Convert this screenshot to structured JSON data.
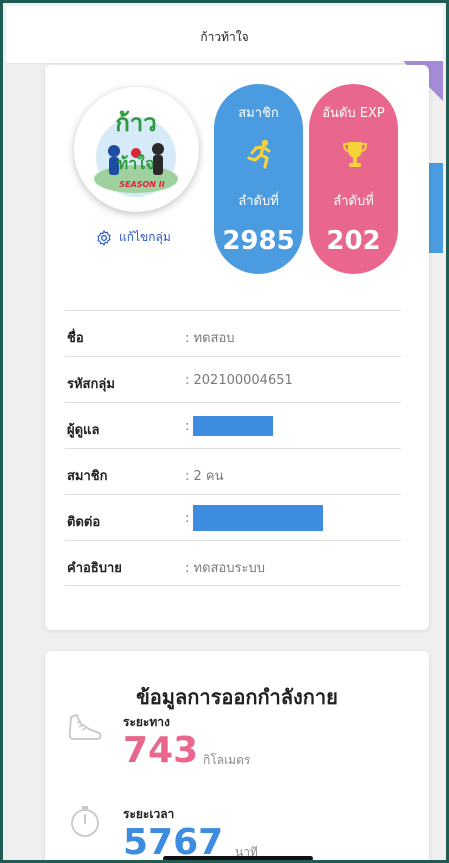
{
  "header": {
    "title": "ก้าวท้าใจ"
  },
  "profile": {
    "edit_label": "แก้ไขกลุ่ม",
    "logo": {
      "top_text": "ก้าว",
      "bottom_text": "ท้าใจ",
      "season_text": "SEASON II",
      "colors": {
        "green": "#2e9a3e",
        "blue": "#1c4da0",
        "red": "#d9263a"
      }
    }
  },
  "members_pill": {
    "title": "สมาชิก",
    "rank_label": "ลำดับที่",
    "rank": "2985",
    "color": "#4a9be0",
    "icon": "running-icon"
  },
  "exp_pill": {
    "title": "อันดับ EXP",
    "rank_label": "ลำดับที่",
    "rank": "202",
    "color": "#e9668d",
    "icon": "trophy-icon"
  },
  "group_info": [
    {
      "label": "ชื่อ",
      "value": ": ทดสอบ"
    },
    {
      "label": "รหัสกลุ่ม",
      "value": ": 202100004651"
    },
    {
      "label": "ผู้ดูแล",
      "value": ":"
    },
    {
      "label": "สมาชิก",
      "value": ": 2 คน"
    },
    {
      "label": "ติดต่อ",
      "value": ":"
    },
    {
      "label": "คำอธิบาย",
      "value": ": ทดสอบระบบ"
    }
  ],
  "exercise": {
    "title": "ข้อมูลการออกกำลังกาย",
    "distance": {
      "label": "ระยะทาง",
      "value": "743",
      "unit": "กิโลเมตร",
      "color": "#e9668d",
      "icon": "shoe-icon"
    },
    "duration": {
      "label": "ระยะเวลา",
      "value": "5767",
      "unit": "นาที",
      "color": "#3d8ce0",
      "icon": "stopwatch-icon"
    }
  },
  "colors": {
    "redaction": "#3d8ce0",
    "frame_border": "#1f5c54",
    "link": "#2b59c8"
  }
}
